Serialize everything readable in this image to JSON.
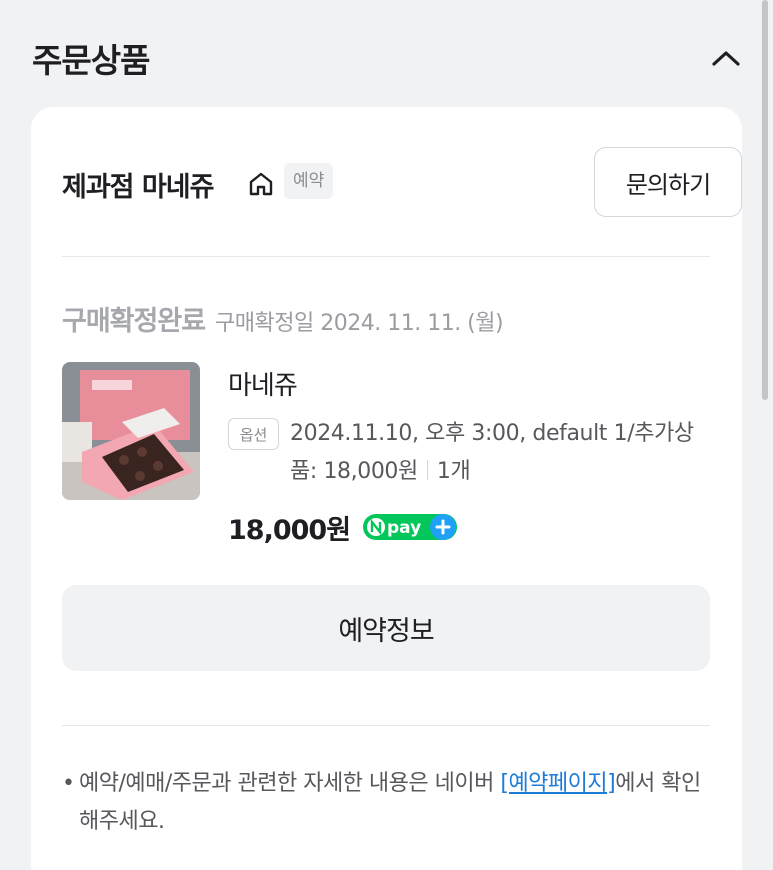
{
  "section": {
    "title": "주문상품"
  },
  "store": {
    "name": "제과점 마네쥬",
    "badge": "예약",
    "inquiry_label": "문의하기"
  },
  "order": {
    "status": "구매확정완료",
    "confirm_date": "구매확정일 2024. 11. 11. (월)",
    "product_name": "마네쥬",
    "option_badge": "옵션",
    "option_text": "2024.11.10, 오후 3:00, default 1/추가상품: 18,000원",
    "quantity": "1개",
    "price": "18,000원",
    "npay_text": "pay"
  },
  "reserve_button_label": "예약정보",
  "notice": {
    "bullet": "•",
    "text_before": "예약/예매/주문과 관련한 자세한 내용은 네이버 ",
    "link": "[예약페이지]",
    "text_after": "에서 확인해주세요."
  },
  "colors": {
    "background": "#f1f2f4",
    "card": "#ffffff",
    "link": "#1d7bda",
    "npay_green": "#03c75a",
    "npay_blue": "#1ea1f7"
  },
  "icons": [
    "chevron-up-icon",
    "home-icon",
    "npay-plus-icon"
  ]
}
